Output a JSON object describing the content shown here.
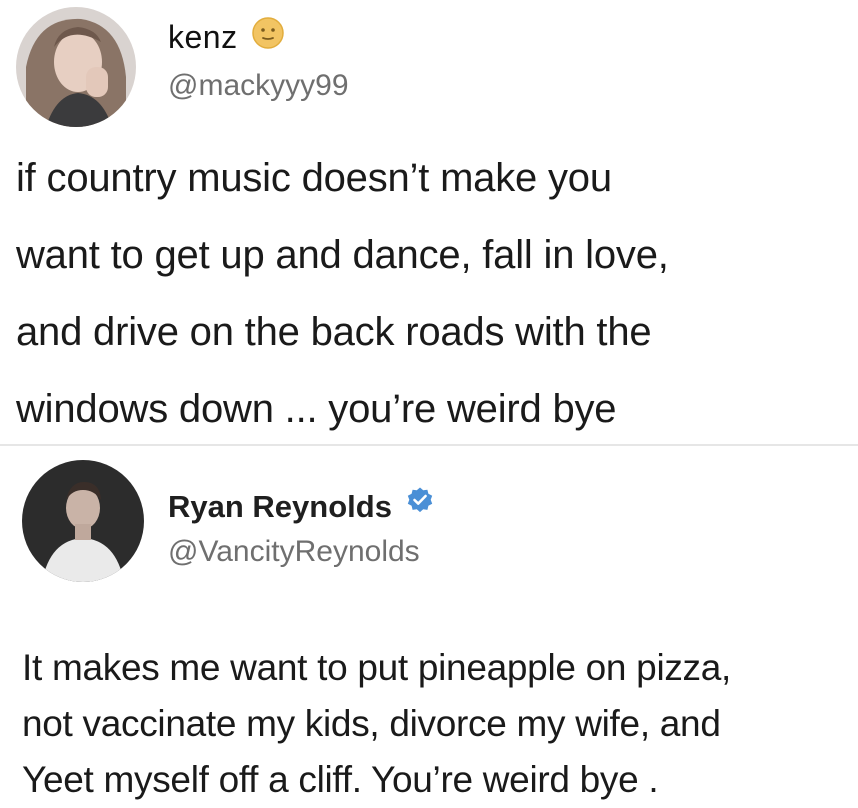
{
  "tweets": [
    {
      "display_name": "kenz",
      "badge_icon": "emoji-face-icon",
      "handle": "@mackyyy99",
      "text_lines": [
        "if country music doesn’t make you",
        "want to get up and dance, fall in love,",
        "and drive on the back roads with the",
        "windows down ... you’re weird bye"
      ]
    },
    {
      "display_name": "Ryan Reynolds",
      "badge_icon": "verified-badge-icon",
      "handle": "@VancityReynolds",
      "text_lines": [
        "It makes me want to put pineapple on pizza,",
        "not vaccinate my kids, divorce  my wife, and",
        "Yeet myself off a cliff. You’re weird bye ."
      ]
    }
  ],
  "colors": {
    "verified": "#4a8fd6",
    "emoji": "#f2c463",
    "handle": "#6f6f6f",
    "divider": "#e6e6e6"
  }
}
